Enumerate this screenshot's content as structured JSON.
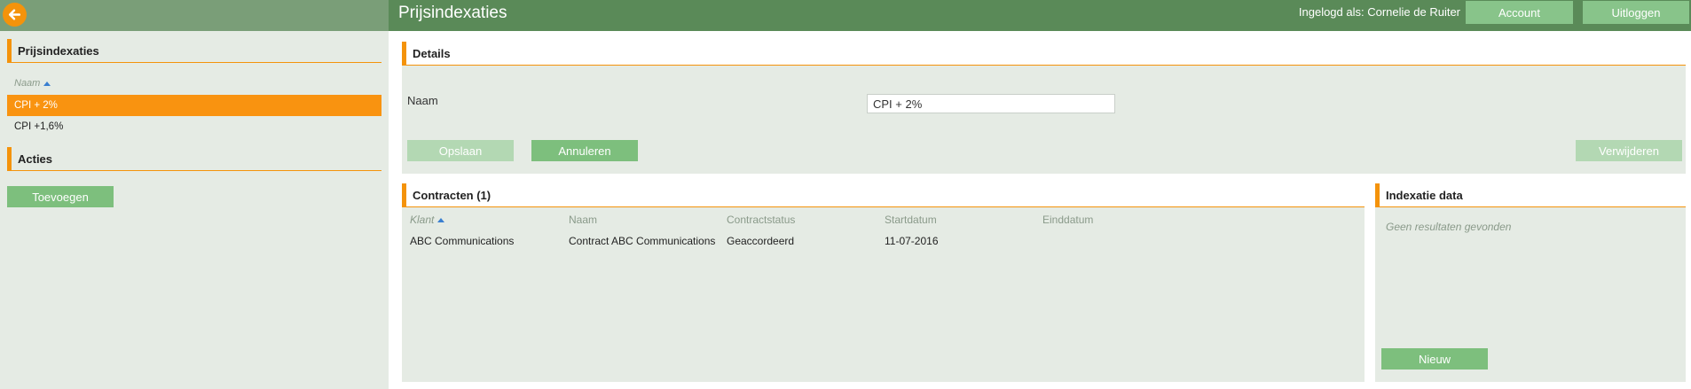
{
  "header": {
    "title": "Prijsindexaties",
    "logged_in": "Ingelogd als: Cornelie de Ruiter",
    "account_label": "Account",
    "logout_label": "Uitloggen",
    "back_icon": "arrow-left-icon"
  },
  "sidebar": {
    "list_heading": "Prijsindexaties",
    "sort_label": "Naam",
    "items": [
      {
        "label": "CPI + 2%",
        "selected": true
      },
      {
        "label": "CPI +1,6%",
        "selected": false
      }
    ],
    "actions_heading": "Acties",
    "add_label": "Toevoegen"
  },
  "details": {
    "heading": "Details",
    "name_label": "Naam",
    "name_value": "CPI + 2%",
    "save_label": "Opslaan",
    "cancel_label": "Annuleren",
    "delete_label": "Verwijderen"
  },
  "contracts": {
    "heading": "Contracten (1)",
    "columns": [
      "Klant",
      "Naam",
      "Contractstatus",
      "Startdatum",
      "Einddatum"
    ],
    "rows": [
      [
        "ABC Communications",
        "Contract ABC Communications",
        "Geaccordeerd",
        "11-07-2016",
        ""
      ]
    ]
  },
  "index_data": {
    "heading": "Indexatie data",
    "empty_text": "Geen resultaten gevonden",
    "new_label": "Nieuw"
  },
  "colors": {
    "accent": "#f4930b",
    "header_green": "#5a8a58",
    "button_green": "#7dbf7d",
    "panel_bg": "#e5ebe4"
  }
}
